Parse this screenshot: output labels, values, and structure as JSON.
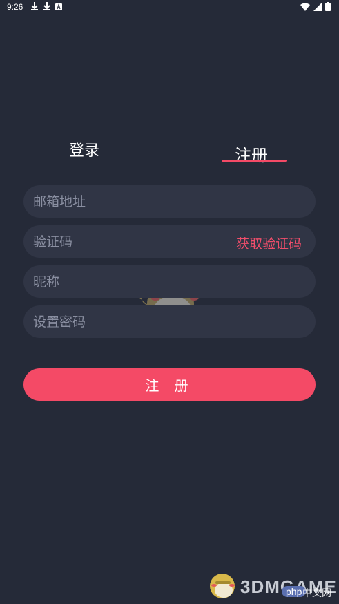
{
  "status_bar": {
    "time": "9:26"
  },
  "tabs": {
    "login": "登录",
    "register": "注册"
  },
  "form": {
    "email_placeholder": "邮箱地址",
    "code_placeholder": "验证码",
    "get_code": "获取验证码",
    "nickname_placeholder": "昵称",
    "password_placeholder": "设置密码"
  },
  "submit_label": "注 册",
  "watermark": {
    "text": "3DMGAME",
    "php": "php",
    "cn": "中文网"
  },
  "colors": {
    "background": "#252a38",
    "field": "#303545",
    "accent": "#f44a66"
  }
}
